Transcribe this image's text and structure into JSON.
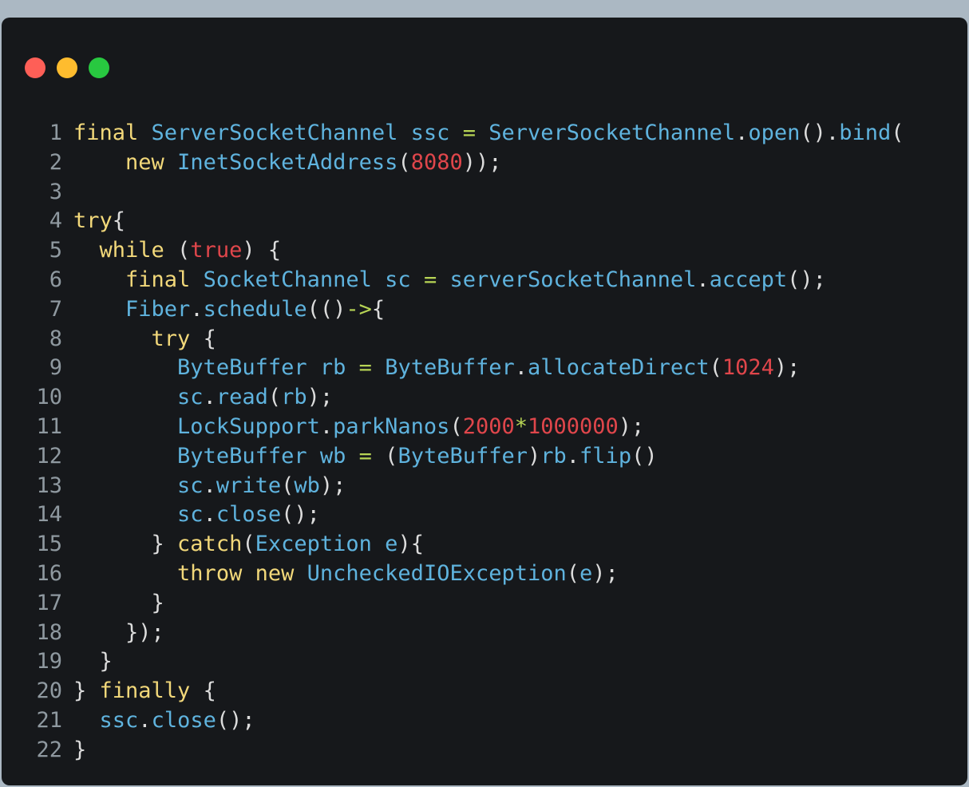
{
  "window": {
    "controls": [
      {
        "name": "close",
        "color": "#fe5f57"
      },
      {
        "name": "minimize",
        "color": "#febc2e"
      },
      {
        "name": "maximize",
        "color": "#28c840"
      }
    ]
  },
  "theme": {
    "background": "#16181b",
    "keyword": "#f2d87a",
    "type": "#5fb3de",
    "number": "#e0464b",
    "operator": "#b7d455",
    "plain": "#dcdcdc",
    "line_number": "#8f99a0"
  },
  "code": {
    "language": "java",
    "lines": [
      {
        "n": "1",
        "tokens": [
          [
            "kw",
            "final"
          ],
          [
            "p",
            " "
          ],
          [
            "ty",
            "ServerSocketChannel"
          ],
          [
            "p",
            " "
          ],
          [
            "id",
            "ssc"
          ],
          [
            "p",
            " "
          ],
          [
            "op",
            "="
          ],
          [
            "p",
            " "
          ],
          [
            "ty",
            "ServerSocketChannel"
          ],
          [
            "p",
            "."
          ],
          [
            "fn",
            "open"
          ],
          [
            "p",
            "()."
          ],
          [
            "fn",
            "bind"
          ],
          [
            "p",
            "("
          ]
        ]
      },
      {
        "n": "2",
        "tokens": [
          [
            "p",
            "    "
          ],
          [
            "kw",
            "new"
          ],
          [
            "p",
            " "
          ],
          [
            "ty",
            "InetSocketAddress"
          ],
          [
            "p",
            "("
          ],
          [
            "num",
            "8080"
          ],
          [
            "p",
            "));"
          ]
        ]
      },
      {
        "n": "3",
        "tokens": []
      },
      {
        "n": "4",
        "tokens": [
          [
            "kw",
            "try"
          ],
          [
            "p",
            "{"
          ]
        ]
      },
      {
        "n": "5",
        "tokens": [
          [
            "p",
            "  "
          ],
          [
            "kw",
            "while"
          ],
          [
            "p",
            " ("
          ],
          [
            "lit",
            "true"
          ],
          [
            "p",
            ") {"
          ]
        ]
      },
      {
        "n": "6",
        "tokens": [
          [
            "p",
            "    "
          ],
          [
            "kw",
            "final"
          ],
          [
            "p",
            " "
          ],
          [
            "ty",
            "SocketChannel"
          ],
          [
            "p",
            " "
          ],
          [
            "id",
            "sc"
          ],
          [
            "p",
            " "
          ],
          [
            "op",
            "="
          ],
          [
            "p",
            " "
          ],
          [
            "id",
            "serverSocketChannel"
          ],
          [
            "p",
            "."
          ],
          [
            "fn",
            "accept"
          ],
          [
            "p",
            "();"
          ]
        ]
      },
      {
        "n": "7",
        "tokens": [
          [
            "p",
            "    "
          ],
          [
            "ty",
            "Fiber"
          ],
          [
            "p",
            "."
          ],
          [
            "fn",
            "schedule"
          ],
          [
            "p",
            "(()"
          ],
          [
            "op",
            "->"
          ],
          [
            "p",
            "{"
          ]
        ]
      },
      {
        "n": "8",
        "tokens": [
          [
            "p",
            "      "
          ],
          [
            "kw",
            "try"
          ],
          [
            "p",
            " {"
          ]
        ]
      },
      {
        "n": "9",
        "tokens": [
          [
            "p",
            "        "
          ],
          [
            "ty",
            "ByteBuffer"
          ],
          [
            "p",
            " "
          ],
          [
            "id",
            "rb"
          ],
          [
            "p",
            " "
          ],
          [
            "op",
            "="
          ],
          [
            "p",
            " "
          ],
          [
            "ty",
            "ByteBuffer"
          ],
          [
            "p",
            "."
          ],
          [
            "fn",
            "allocateDirect"
          ],
          [
            "p",
            "("
          ],
          [
            "num",
            "1024"
          ],
          [
            "p",
            ");"
          ]
        ]
      },
      {
        "n": "10",
        "tokens": [
          [
            "p",
            "        "
          ],
          [
            "id",
            "sc"
          ],
          [
            "p",
            "."
          ],
          [
            "fn",
            "read"
          ],
          [
            "p",
            "("
          ],
          [
            "id",
            "rb"
          ],
          [
            "p",
            ");"
          ]
        ]
      },
      {
        "n": "11",
        "tokens": [
          [
            "p",
            "        "
          ],
          [
            "ty",
            "LockSupport"
          ],
          [
            "p",
            "."
          ],
          [
            "fn",
            "parkNanos"
          ],
          [
            "p",
            "("
          ],
          [
            "num",
            "2000"
          ],
          [
            "op",
            "*"
          ],
          [
            "num",
            "1000000"
          ],
          [
            "p",
            ");"
          ]
        ]
      },
      {
        "n": "12",
        "tokens": [
          [
            "p",
            "        "
          ],
          [
            "ty",
            "ByteBuffer"
          ],
          [
            "p",
            " "
          ],
          [
            "id",
            "wb"
          ],
          [
            "p",
            " "
          ],
          [
            "op",
            "="
          ],
          [
            "p",
            " ("
          ],
          [
            "ty",
            "ByteBuffer"
          ],
          [
            "p",
            ")"
          ],
          [
            "id",
            "rb"
          ],
          [
            "p",
            "."
          ],
          [
            "fn",
            "flip"
          ],
          [
            "p",
            "()"
          ]
        ]
      },
      {
        "n": "13",
        "tokens": [
          [
            "p",
            "        "
          ],
          [
            "id",
            "sc"
          ],
          [
            "p",
            "."
          ],
          [
            "fn",
            "write"
          ],
          [
            "p",
            "("
          ],
          [
            "id",
            "wb"
          ],
          [
            "p",
            ");"
          ]
        ]
      },
      {
        "n": "14",
        "tokens": [
          [
            "p",
            "        "
          ],
          [
            "id",
            "sc"
          ],
          [
            "p",
            "."
          ],
          [
            "fn",
            "close"
          ],
          [
            "p",
            "();"
          ]
        ]
      },
      {
        "n": "15",
        "tokens": [
          [
            "p",
            "      } "
          ],
          [
            "kw",
            "catch"
          ],
          [
            "p",
            "("
          ],
          [
            "ty",
            "Exception"
          ],
          [
            "p",
            " "
          ],
          [
            "id",
            "e"
          ],
          [
            "p",
            "){"
          ]
        ]
      },
      {
        "n": "16",
        "tokens": [
          [
            "p",
            "        "
          ],
          [
            "kw",
            "throw"
          ],
          [
            "p",
            " "
          ],
          [
            "kw",
            "new"
          ],
          [
            "p",
            " "
          ],
          [
            "ty",
            "UncheckedIOException"
          ],
          [
            "p",
            "("
          ],
          [
            "id",
            "e"
          ],
          [
            "p",
            ");"
          ]
        ]
      },
      {
        "n": "17",
        "tokens": [
          [
            "p",
            "      }"
          ]
        ]
      },
      {
        "n": "18",
        "tokens": [
          [
            "p",
            "    });"
          ]
        ]
      },
      {
        "n": "19",
        "tokens": [
          [
            "p",
            "  }"
          ]
        ]
      },
      {
        "n": "20",
        "tokens": [
          [
            "p",
            "} "
          ],
          [
            "kw",
            "finally"
          ],
          [
            "p",
            " {"
          ]
        ]
      },
      {
        "n": "21",
        "tokens": [
          [
            "p",
            "  "
          ],
          [
            "id",
            "ssc"
          ],
          [
            "p",
            "."
          ],
          [
            "fn",
            "close"
          ],
          [
            "p",
            "();"
          ]
        ]
      },
      {
        "n": "22",
        "tokens": [
          [
            "p",
            "}"
          ]
        ]
      }
    ]
  }
}
